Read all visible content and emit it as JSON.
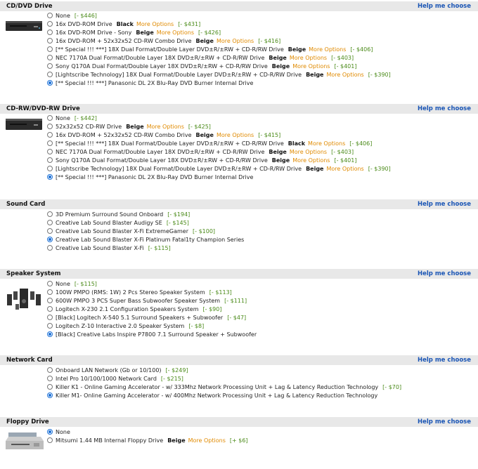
{
  "help_label": "Help me choose",
  "more_label": "More Options",
  "sections": [
    {
      "title": "CD/DVD Drive",
      "options": [
        {
          "name": "None",
          "color": "",
          "more": false,
          "price": "[- $446]",
          "selected": false
        },
        {
          "name": "16x DVD-ROM Drive",
          "color": "Black",
          "more": true,
          "price": "[- $431]",
          "selected": false
        },
        {
          "name": "16x DVD-ROM Drive - Sony",
          "color": "Beige",
          "more": true,
          "price": "[- $426]",
          "selected": false
        },
        {
          "name": "16x DVD-ROM + 52x32x52 CD-RW Combo Drive",
          "color": "Beige",
          "more": true,
          "price": "[- $416]",
          "selected": false
        },
        {
          "name": "[** Special !!! ***] 18X Dual Format/Double Layer DVD±R/±RW + CD-R/RW Drive",
          "color": "Beige",
          "more": true,
          "price": "[- $406]",
          "selected": false
        },
        {
          "name": "NEC 7170A Dual Format/Double Layer 18X DVD±R/±RW + CD-R/RW Drive",
          "color": "Beige",
          "more": true,
          "price": "[- $403]",
          "selected": false
        },
        {
          "name": "Sony Q170A Dual Format/Double Layer 18X DVD±R/±RW + CD-R/RW Drive",
          "color": "Beige",
          "more": true,
          "price": "[- $401]",
          "selected": false
        },
        {
          "name": "[Lightscribe Technology] 18X Dual Format/Double Layer DVD±R/±RW + CD-R/RW Drive",
          "color": "Beige",
          "more": true,
          "price": "[- $390]",
          "selected": false
        },
        {
          "name": "[** Special !!! ***] Panasonic DL 2X Blu-Ray DVD Burner Internal Drive",
          "color": "",
          "more": false,
          "price": "",
          "selected": true
        }
      ]
    },
    {
      "title": "CD-RW/DVD-RW Drive",
      "options": [
        {
          "name": "None",
          "color": "",
          "more": false,
          "price": "[- $442]",
          "selected": false
        },
        {
          "name": "52x32x52 CD-RW Drive",
          "color": "Beige",
          "more": true,
          "price": "[- $425]",
          "selected": false
        },
        {
          "name": "16x DVD-ROM + 52x32x52 CD-RW Combo Drive",
          "color": "Beige",
          "more": true,
          "price": "[- $415]",
          "selected": false
        },
        {
          "name": "[** Special !!! ***] 18X Dual Format/Double Layer DVD±R/±RW + CD-R/RW Drive",
          "color": "Black",
          "more": true,
          "price": "[- $406]",
          "selected": false
        },
        {
          "name": "NEC 7170A Dual Format/Double Layer 18X DVD±R/±RW + CD-R/RW Drive",
          "color": "Beige",
          "more": true,
          "price": "[- $403]",
          "selected": false
        },
        {
          "name": "Sony Q170A Dual Format/Double Layer 18X DVD±R/±RW + CD-R/RW Drive",
          "color": "Beige",
          "more": true,
          "price": "[- $401]",
          "selected": false
        },
        {
          "name": "[Lightscribe Technology] 18X Dual Format/Double Layer DVD±R/±RW + CD-R/RW Drive",
          "color": "Beige",
          "more": true,
          "price": "[- $390]",
          "selected": false
        },
        {
          "name": "[** Special !!! ***] Panasonic DL 2X Blu-Ray DVD Burner Internal Drive",
          "color": "",
          "more": false,
          "price": "",
          "selected": true
        }
      ]
    },
    {
      "title": "Sound Card",
      "options": [
        {
          "name": "3D Premium Surround Sound Onboard",
          "color": "",
          "more": false,
          "price": "[- $194]",
          "selected": false
        },
        {
          "name": "Creative Lab Sound Blaster Audigy SE",
          "color": "",
          "more": false,
          "price": "[- $145]",
          "selected": false
        },
        {
          "name": "Creative Lab Sound Blaster X-Fi ExtremeGamer",
          "color": "",
          "more": false,
          "price": "[- $100]",
          "selected": false
        },
        {
          "name": "Creative Lab Sound Blaster X-Fi Platinum Fatal1ty Champion Series",
          "color": "",
          "more": false,
          "price": "",
          "selected": true
        },
        {
          "name": "Creative Lab Sound Blaster X-Fi",
          "color": "",
          "more": false,
          "price": "[- $115]",
          "selected": false
        }
      ]
    },
    {
      "title": "Speaker System",
      "options": [
        {
          "name": "None",
          "color": "",
          "more": false,
          "price": "[- $115]",
          "selected": false
        },
        {
          "name": "100W PMPO (RMS: 1W) 2 Pcs Stereo Speaker System",
          "color": "",
          "more": false,
          "price": "[- $113]",
          "selected": false
        },
        {
          "name": "600W PMPO 3 PCS Super Bass Subwoofer Speaker System",
          "color": "",
          "more": false,
          "price": "[- $111]",
          "selected": false
        },
        {
          "name": "Logitech X-230 2.1 Configuration Speakers System",
          "color": "",
          "more": false,
          "price": "[- $90]",
          "selected": false
        },
        {
          "name": "[Black] Logitech X-540 5.1 Surround Speakers + Subwoofer",
          "color": "",
          "more": false,
          "price": "[- $47]",
          "selected": false
        },
        {
          "name": "Logitech Z-10 Interactive 2.0 Speaker System",
          "color": "",
          "more": false,
          "price": "[- $8]",
          "selected": false
        },
        {
          "name": "[Black] Creative Labs Inspire P7800 7.1 Surround Speaker + Subwoofer",
          "color": "",
          "more": false,
          "price": "",
          "selected": true
        }
      ]
    },
    {
      "title": "Network Card",
      "options": [
        {
          "name": "Onboard LAN Network (Gb or 10/100)",
          "color": "",
          "more": false,
          "price": "[- $249]",
          "selected": false
        },
        {
          "name": "Intel Pro 10/100/1000 Network Card",
          "color": "",
          "more": false,
          "price": "[- $215]",
          "selected": false
        },
        {
          "name": "Killer K1 - Online Gaming Accelerator - w/ 333Mhz Network Processing Unit + Lag & Latency Reduction Technology",
          "color": "",
          "more": false,
          "price": "[- $70]",
          "selected": false
        },
        {
          "name": "Killer M1- Online Gaming Accelerator - w/ 400Mhz Network Processing Unit + Lag & Latency Reduction Technology",
          "color": "",
          "more": false,
          "price": "",
          "selected": true
        }
      ]
    },
    {
      "title": "Floppy Drive",
      "options": [
        {
          "name": "None",
          "color": "",
          "more": false,
          "price": "",
          "selected": true
        },
        {
          "name": "Mitsumi 1.44 MB Internal Floppy Drive",
          "color": "Beige",
          "more": true,
          "price": "[+ $6]",
          "selected": false
        }
      ]
    }
  ]
}
